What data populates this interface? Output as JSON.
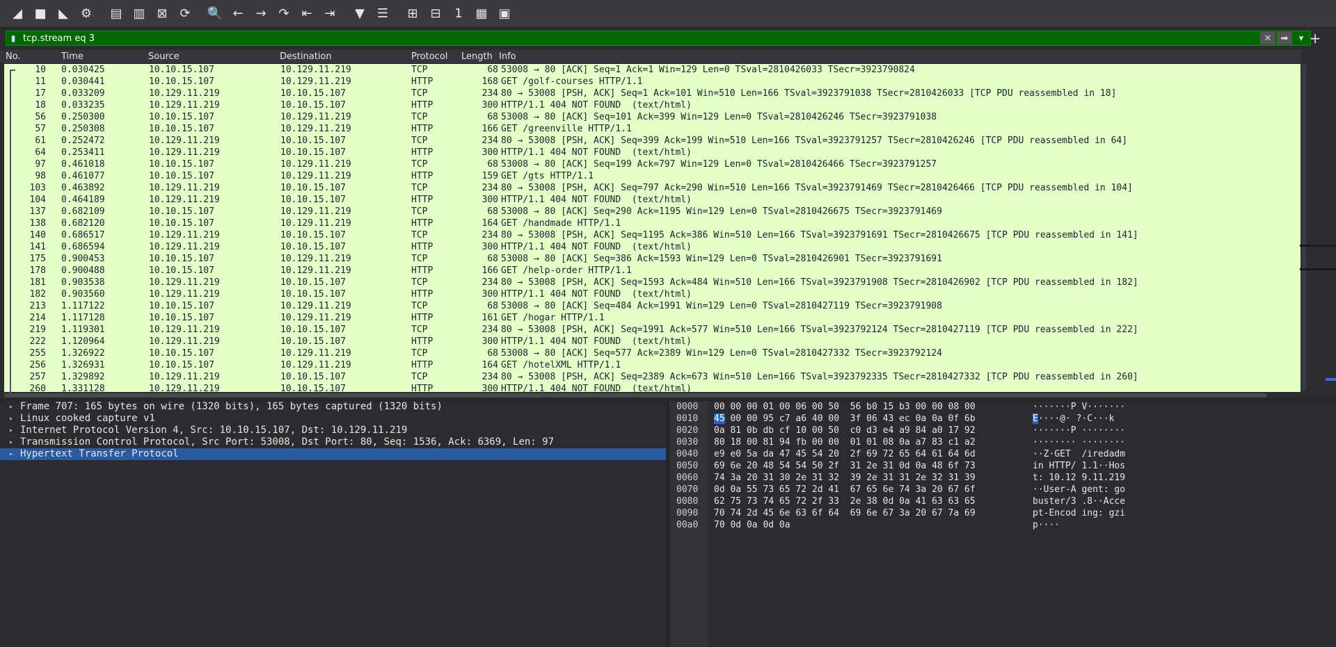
{
  "toolbar": {
    "buttons": [
      {
        "name": "start-capture-icon",
        "glyph": "◢"
      },
      {
        "name": "stop-capture-icon",
        "glyph": "■"
      },
      {
        "name": "restart-capture-icon",
        "glyph": "◣"
      },
      {
        "name": "capture-options-icon",
        "glyph": "⚙"
      },
      {
        "name": "open-file-icon",
        "glyph": "▤"
      },
      {
        "name": "save-file-icon",
        "glyph": "▥"
      },
      {
        "name": "close-file-icon",
        "glyph": "⊠"
      },
      {
        "name": "reload-file-icon",
        "glyph": "⟳"
      },
      {
        "name": "find-packet-icon",
        "glyph": "🔍"
      },
      {
        "name": "go-back-icon",
        "glyph": "←"
      },
      {
        "name": "go-forward-icon",
        "glyph": "→"
      },
      {
        "name": "go-to-packet-icon",
        "glyph": "↷"
      },
      {
        "name": "first-packet-icon",
        "glyph": "⇤"
      },
      {
        "name": "last-packet-icon",
        "glyph": "⇥"
      },
      {
        "name": "auto-scroll-icon",
        "glyph": "▼"
      },
      {
        "name": "colorize-icon",
        "glyph": "☰"
      },
      {
        "name": "zoom-in-icon",
        "glyph": "⊞"
      },
      {
        "name": "zoom-out-icon",
        "glyph": "⊟"
      },
      {
        "name": "normal-size-icon",
        "glyph": "1"
      },
      {
        "name": "resize-columns-icon",
        "glyph": "▦"
      },
      {
        "name": "layout-icon",
        "glyph": "▣"
      }
    ]
  },
  "filter": {
    "value": "tcp.stream eq 3",
    "clear_glyph": "✕",
    "apply_glyph": "➡",
    "dropdown_glyph": "▾",
    "add_glyph": "+"
  },
  "columns": {
    "no": "No.",
    "time": "Time",
    "source": "Source",
    "destination": "Destination",
    "protocol": "Protocol",
    "length": "Length",
    "info": "Info"
  },
  "packets": [
    {
      "no": "10",
      "time": "0.030425",
      "src": "10.10.15.107",
      "dst": "10.129.11.219",
      "proto": "TCP",
      "len": "68",
      "info": "53008 → 80 [ACK] Seq=1 Ack=1 Win=129 Len=0 TSval=2810426033 TSecr=3923790824"
    },
    {
      "no": "11",
      "time": "0.030441",
      "src": "10.10.15.107",
      "dst": "10.129.11.219",
      "proto": "HTTP",
      "len": "168",
      "info": "GET /golf-courses HTTP/1.1"
    },
    {
      "no": "17",
      "time": "0.033209",
      "src": "10.129.11.219",
      "dst": "10.10.15.107",
      "proto": "TCP",
      "len": "234",
      "info": "80 → 53008 [PSH, ACK] Seq=1 Ack=101 Win=510 Len=166 TSval=3923791038 TSecr=2810426033 [TCP PDU reassembled in 18]"
    },
    {
      "no": "18",
      "time": "0.033235",
      "src": "10.129.11.219",
      "dst": "10.10.15.107",
      "proto": "HTTP",
      "len": "300",
      "info": "HTTP/1.1 404 NOT FOUND  (text/html)"
    },
    {
      "no": "56",
      "time": "0.250300",
      "src": "10.10.15.107",
      "dst": "10.129.11.219",
      "proto": "TCP",
      "len": "68",
      "info": "53008 → 80 [ACK] Seq=101 Ack=399 Win=129 Len=0 TSval=2810426246 TSecr=3923791038"
    },
    {
      "no": "57",
      "time": "0.250308",
      "src": "10.10.15.107",
      "dst": "10.129.11.219",
      "proto": "HTTP",
      "len": "166",
      "info": "GET /greenville HTTP/1.1"
    },
    {
      "no": "61",
      "time": "0.252472",
      "src": "10.129.11.219",
      "dst": "10.10.15.107",
      "proto": "TCP",
      "len": "234",
      "info": "80 → 53008 [PSH, ACK] Seq=399 Ack=199 Win=510 Len=166 TSval=3923791257 TSecr=2810426246 [TCP PDU reassembled in 64]"
    },
    {
      "no": "64",
      "time": "0.253411",
      "src": "10.129.11.219",
      "dst": "10.10.15.107",
      "proto": "HTTP",
      "len": "300",
      "info": "HTTP/1.1 404 NOT FOUND  (text/html)"
    },
    {
      "no": "97",
      "time": "0.461018",
      "src": "10.10.15.107",
      "dst": "10.129.11.219",
      "proto": "TCP",
      "len": "68",
      "info": "53008 → 80 [ACK] Seq=199 Ack=797 Win=129 Len=0 TSval=2810426466 TSecr=3923791257"
    },
    {
      "no": "98",
      "time": "0.461077",
      "src": "10.10.15.107",
      "dst": "10.129.11.219",
      "proto": "HTTP",
      "len": "159",
      "info": "GET /gts HTTP/1.1"
    },
    {
      "no": "103",
      "time": "0.463892",
      "src": "10.129.11.219",
      "dst": "10.10.15.107",
      "proto": "TCP",
      "len": "234",
      "info": "80 → 53008 [PSH, ACK] Seq=797 Ack=290 Win=510 Len=166 TSval=3923791469 TSecr=2810426466 [TCP PDU reassembled in 104]"
    },
    {
      "no": "104",
      "time": "0.464189",
      "src": "10.129.11.219",
      "dst": "10.10.15.107",
      "proto": "HTTP",
      "len": "300",
      "info": "HTTP/1.1 404 NOT FOUND  (text/html)"
    },
    {
      "no": "137",
      "time": "0.682109",
      "src": "10.10.15.107",
      "dst": "10.129.11.219",
      "proto": "TCP",
      "len": "68",
      "info": "53008 → 80 [ACK] Seq=290 Ack=1195 Win=129 Len=0 TSval=2810426675 TSecr=3923791469"
    },
    {
      "no": "138",
      "time": "0.682120",
      "src": "10.10.15.107",
      "dst": "10.129.11.219",
      "proto": "HTTP",
      "len": "164",
      "info": "GET /handmade HTTP/1.1"
    },
    {
      "no": "140",
      "time": "0.686517",
      "src": "10.129.11.219",
      "dst": "10.10.15.107",
      "proto": "TCP",
      "len": "234",
      "info": "80 → 53008 [PSH, ACK] Seq=1195 Ack=386 Win=510 Len=166 TSval=3923791691 TSecr=2810426675 [TCP PDU reassembled in 141]"
    },
    {
      "no": "141",
      "time": "0.686594",
      "src": "10.129.11.219",
      "dst": "10.10.15.107",
      "proto": "HTTP",
      "len": "300",
      "info": "HTTP/1.1 404 NOT FOUND  (text/html)"
    },
    {
      "no": "175",
      "time": "0.900453",
      "src": "10.10.15.107",
      "dst": "10.129.11.219",
      "proto": "TCP",
      "len": "68",
      "info": "53008 → 80 [ACK] Seq=386 Ack=1593 Win=129 Len=0 TSval=2810426901 TSecr=3923791691"
    },
    {
      "no": "178",
      "time": "0.900488",
      "src": "10.10.15.107",
      "dst": "10.129.11.219",
      "proto": "HTTP",
      "len": "166",
      "info": "GET /help-order HTTP/1.1"
    },
    {
      "no": "181",
      "time": "0.903538",
      "src": "10.129.11.219",
      "dst": "10.10.15.107",
      "proto": "TCP",
      "len": "234",
      "info": "80 → 53008 [PSH, ACK] Seq=1593 Ack=484 Win=510 Len=166 TSval=3923791908 TSecr=2810426902 [TCP PDU reassembled in 182]"
    },
    {
      "no": "182",
      "time": "0.903560",
      "src": "10.129.11.219",
      "dst": "10.10.15.107",
      "proto": "HTTP",
      "len": "300",
      "info": "HTTP/1.1 404 NOT FOUND  (text/html)"
    },
    {
      "no": "213",
      "time": "1.117122",
      "src": "10.10.15.107",
      "dst": "10.129.11.219",
      "proto": "TCP",
      "len": "68",
      "info": "53008 → 80 [ACK] Seq=484 Ack=1991 Win=129 Len=0 TSval=2810427119 TSecr=3923791908"
    },
    {
      "no": "214",
      "time": "1.117128",
      "src": "10.10.15.107",
      "dst": "10.129.11.219",
      "proto": "HTTP",
      "len": "161",
      "info": "GET /hogar HTTP/1.1"
    },
    {
      "no": "219",
      "time": "1.119301",
      "src": "10.129.11.219",
      "dst": "10.10.15.107",
      "proto": "TCP",
      "len": "234",
      "info": "80 → 53008 [PSH, ACK] Seq=1991 Ack=577 Win=510 Len=166 TSval=3923792124 TSecr=2810427119 [TCP PDU reassembled in 222]"
    },
    {
      "no": "222",
      "time": "1.120964",
      "src": "10.129.11.219",
      "dst": "10.10.15.107",
      "proto": "HTTP",
      "len": "300",
      "info": "HTTP/1.1 404 NOT FOUND  (text/html)"
    },
    {
      "no": "255",
      "time": "1.326922",
      "src": "10.10.15.107",
      "dst": "10.129.11.219",
      "proto": "TCP",
      "len": "68",
      "info": "53008 → 80 [ACK] Seq=577 Ack=2389 Win=129 Len=0 TSval=2810427332 TSecr=3923792124"
    },
    {
      "no": "256",
      "time": "1.326931",
      "src": "10.10.15.107",
      "dst": "10.129.11.219",
      "proto": "HTTP",
      "len": "164",
      "info": "GET /hotelXML HTTP/1.1"
    },
    {
      "no": "257",
      "time": "1.329892",
      "src": "10.129.11.219",
      "dst": "10.10.15.107",
      "proto": "TCP",
      "len": "234",
      "info": "80 → 53008 [PSH, ACK] Seq=2389 Ack=673 Win=510 Len=166 TSval=3923792335 TSecr=2810427332 [TCP PDU reassembled in 260]"
    },
    {
      "no": "260",
      "time": "1.331128",
      "src": "10.129.11.219",
      "dst": "10.10.15.107",
      "proto": "HTTP",
      "len": "300",
      "info": "HTTP/1.1 404 NOT FOUND  (text/html)"
    }
  ],
  "details": [
    {
      "text": "Frame 707: 165 bytes on wire (1320 bits), 165 bytes captured (1320 bits)",
      "selected": false
    },
    {
      "text": "Linux cooked capture v1",
      "selected": false
    },
    {
      "text": "Internet Protocol Version 4, Src: 10.10.15.107, Dst: 10.129.11.219",
      "selected": false
    },
    {
      "text": "Transmission Control Protocol, Src Port: 53008, Dst Port: 80, Seq: 1536, Ack: 6369, Len: 97",
      "selected": false
    },
    {
      "text": "Hypertext Transfer Protocol",
      "selected": true
    }
  ],
  "expander_glyph": "▸",
  "bytes": [
    {
      "offset": "0000",
      "hex": "00 00 00 01 00 06 00 50  56 b0 15 b3 00 00 08 00",
      "ascii": "·······P V·······"
    },
    {
      "offset": "0010",
      "hex_hl": "45",
      "hex": " 00 00 95 c7 a6 40 00  3f 06 43 ec 0a 0a 0f 6b",
      "ascii_hl": "E",
      "ascii": "····@· ?·C···k"
    },
    {
      "offset": "0020",
      "hex": "0a 81 0b db cf 10 00 50  c0 d3 e4 a9 84 a0 17 92",
      "ascii": "·······P ········"
    },
    {
      "offset": "0030",
      "hex": "80 18 00 81 94 fb 00 00  01 01 08 0a a7 83 c1 a2",
      "ascii": "········ ········"
    },
    {
      "offset": "0040",
      "hex": "e9 e0 5a da 47 45 54 20  2f 69 72 65 64 61 64 6d",
      "ascii": "··Z·GET  /iredadm"
    },
    {
      "offset": "0050",
      "hex": "69 6e 20 48 54 54 50 2f  31 2e 31 0d 0a 48 6f 73",
      "ascii": "in HTTP/ 1.1··Hos"
    },
    {
      "offset": "0060",
      "hex": "74 3a 20 31 30 2e 31 32  39 2e 31 31 2e 32 31 39",
      "ascii": "t: 10.12 9.11.219"
    },
    {
      "offset": "0070",
      "hex": "0d 0a 55 73 65 72 2d 41  67 65 6e 74 3a 20 67 6f",
      "ascii": "··User-A gent: go"
    },
    {
      "offset": "0080",
      "hex": "62 75 73 74 65 72 2f 33  2e 38 0d 0a 41 63 63 65",
      "ascii": "buster/3 .8··Acce"
    },
    {
      "offset": "0090",
      "hex": "70 74 2d 45 6e 63 6f 64  69 6e 67 3a 20 67 7a 69",
      "ascii": "pt-Encod ing: gzi"
    },
    {
      "offset": "00a0",
      "hex": "70 0d 0a 0d 0a",
      "ascii": "p····"
    }
  ],
  "colors": {
    "row_background": "#e4ffc7",
    "filter_valid": "#006600",
    "selection": "#2a5aa0"
  }
}
